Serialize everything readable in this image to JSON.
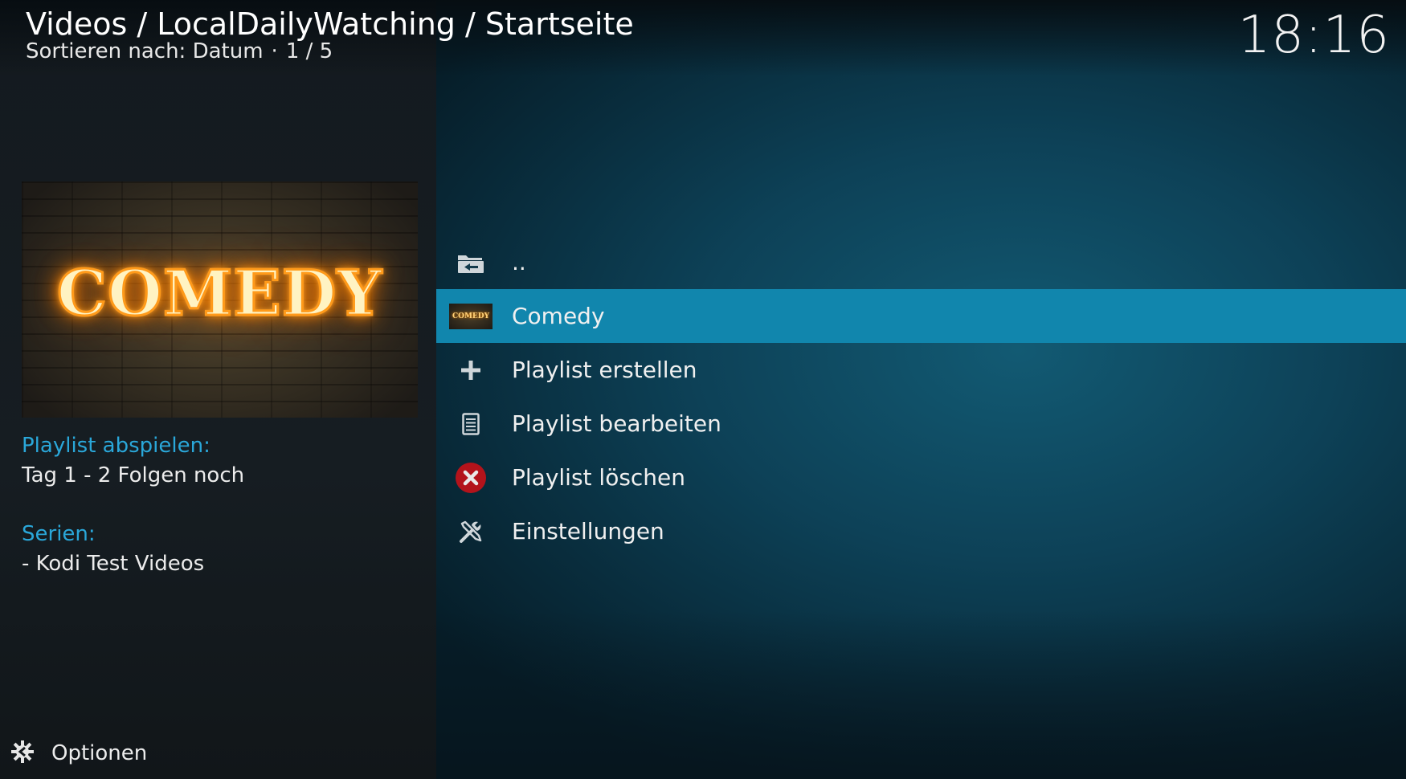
{
  "header": {
    "breadcrumb": "Videos / LocalDailyWatching / Startseite",
    "sort_label": "Sortieren nach: Datum",
    "sort_separator": "·",
    "position": "1 / 5",
    "clock": "18:16"
  },
  "preview": {
    "thumbnail_text": "COMEDY"
  },
  "info": {
    "playlist_label": "Playlist abspielen:",
    "playlist_value": "Tag 1 - 2 Folgen noch",
    "series_label": "Serien:",
    "series_value": "- Kodi Test Videos"
  },
  "list": {
    "items": [
      {
        "label": "..",
        "icon": "folder-back-icon"
      },
      {
        "label": "Comedy",
        "icon": "comedy-thumbnail",
        "selected": true,
        "thumb_text": "COMEDY"
      },
      {
        "label": "Playlist erstellen",
        "icon": "plus-icon"
      },
      {
        "label": "Playlist bearbeiten",
        "icon": "document-icon"
      },
      {
        "label": "Playlist löschen",
        "icon": "delete-icon"
      },
      {
        "label": "Einstellungen",
        "icon": "tools-icon"
      }
    ]
  },
  "footer": {
    "options_label": "Optionen",
    "options_icon": "options-icon"
  },
  "colors": {
    "accent": "#2aa7d9",
    "selection": "#1186ad",
    "delete_red": "#b3131b"
  }
}
